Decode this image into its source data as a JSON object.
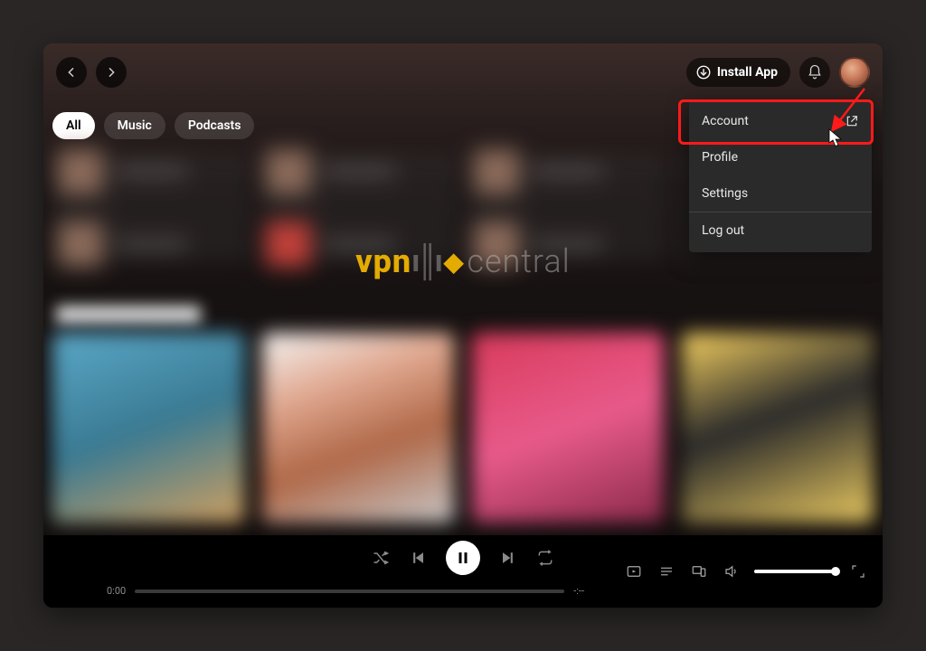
{
  "topbar": {
    "install_label": "Install App"
  },
  "filters": {
    "tabs": [
      {
        "label": "All",
        "active": true
      },
      {
        "label": "Music",
        "active": false
      },
      {
        "label": "Podcasts",
        "active": false
      }
    ]
  },
  "user_menu": {
    "items": [
      {
        "label": "Account",
        "external": true,
        "highlighted": true
      },
      {
        "label": "Profile",
        "external": false
      },
      {
        "label": "Settings",
        "external": false
      },
      {
        "label": "Log out",
        "external": false,
        "separator_above": true
      }
    ]
  },
  "player": {
    "elapsed": "0:00",
    "total": "-:--"
  },
  "watermark": {
    "part_a": "vpn",
    "part_b": "central"
  },
  "annotation": {
    "highlight_color": "#ff1a1a"
  }
}
